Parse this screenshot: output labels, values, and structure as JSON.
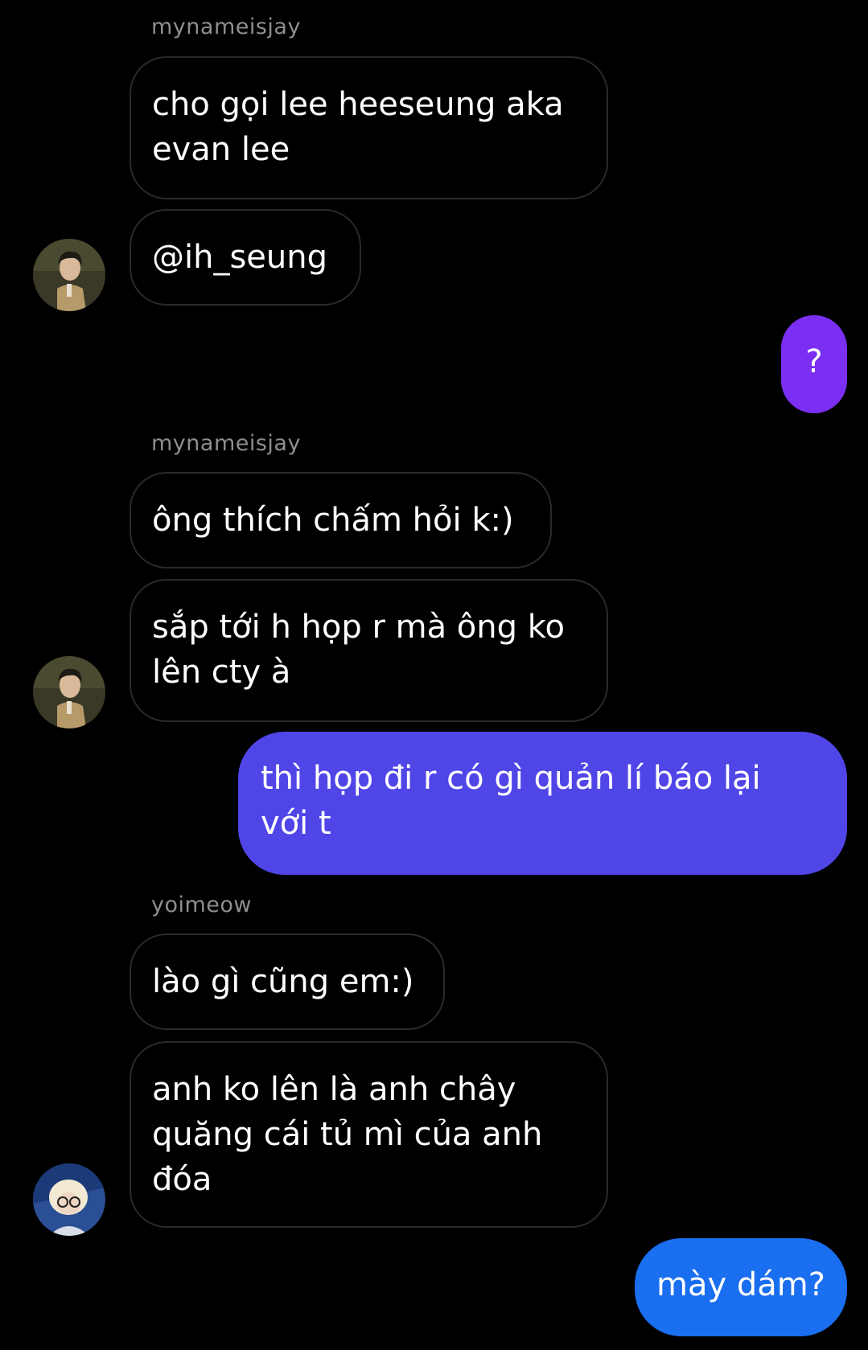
{
  "colors": {
    "background": "#000000",
    "received_border": "#2a2a2a",
    "sender_name": "#8e8e8e",
    "sent_purple": "#7b2ff2",
    "sent_indigo": "#5046e8",
    "sent_blue": "#1a6ef0"
  },
  "messages": [
    {
      "type": "sender",
      "text": "mynameisjay"
    },
    {
      "type": "received",
      "text": "cho gọi lee heeseung aka\nevan lee"
    },
    {
      "type": "received",
      "text": "@ih_seung",
      "avatar": "avatar-jay"
    },
    {
      "type": "sent",
      "text": "?",
      "color": "#7b2ff2"
    },
    {
      "type": "sender",
      "text": "mynameisjay"
    },
    {
      "type": "received",
      "text": "ông thích chấm hỏi k:)"
    },
    {
      "type": "received",
      "text": "sắp tới h họp r mà ông ko\nlên cty à",
      "avatar": "avatar-jay"
    },
    {
      "type": "sent",
      "text": "thì họp đi r có gì quản lí báo lại\nvới t",
      "color": "#5046e8"
    },
    {
      "type": "sender",
      "text": "yoimeow"
    },
    {
      "type": "received",
      "text": "lào gì cũng em:)"
    },
    {
      "type": "received",
      "text": "anh ko lên là anh chây\nquăng cái tủ mì của anh\nđóa",
      "avatar": "avatar-yoimeow"
    },
    {
      "type": "sent",
      "text": "mày dám?",
      "color": "#1a6ef0"
    }
  ]
}
